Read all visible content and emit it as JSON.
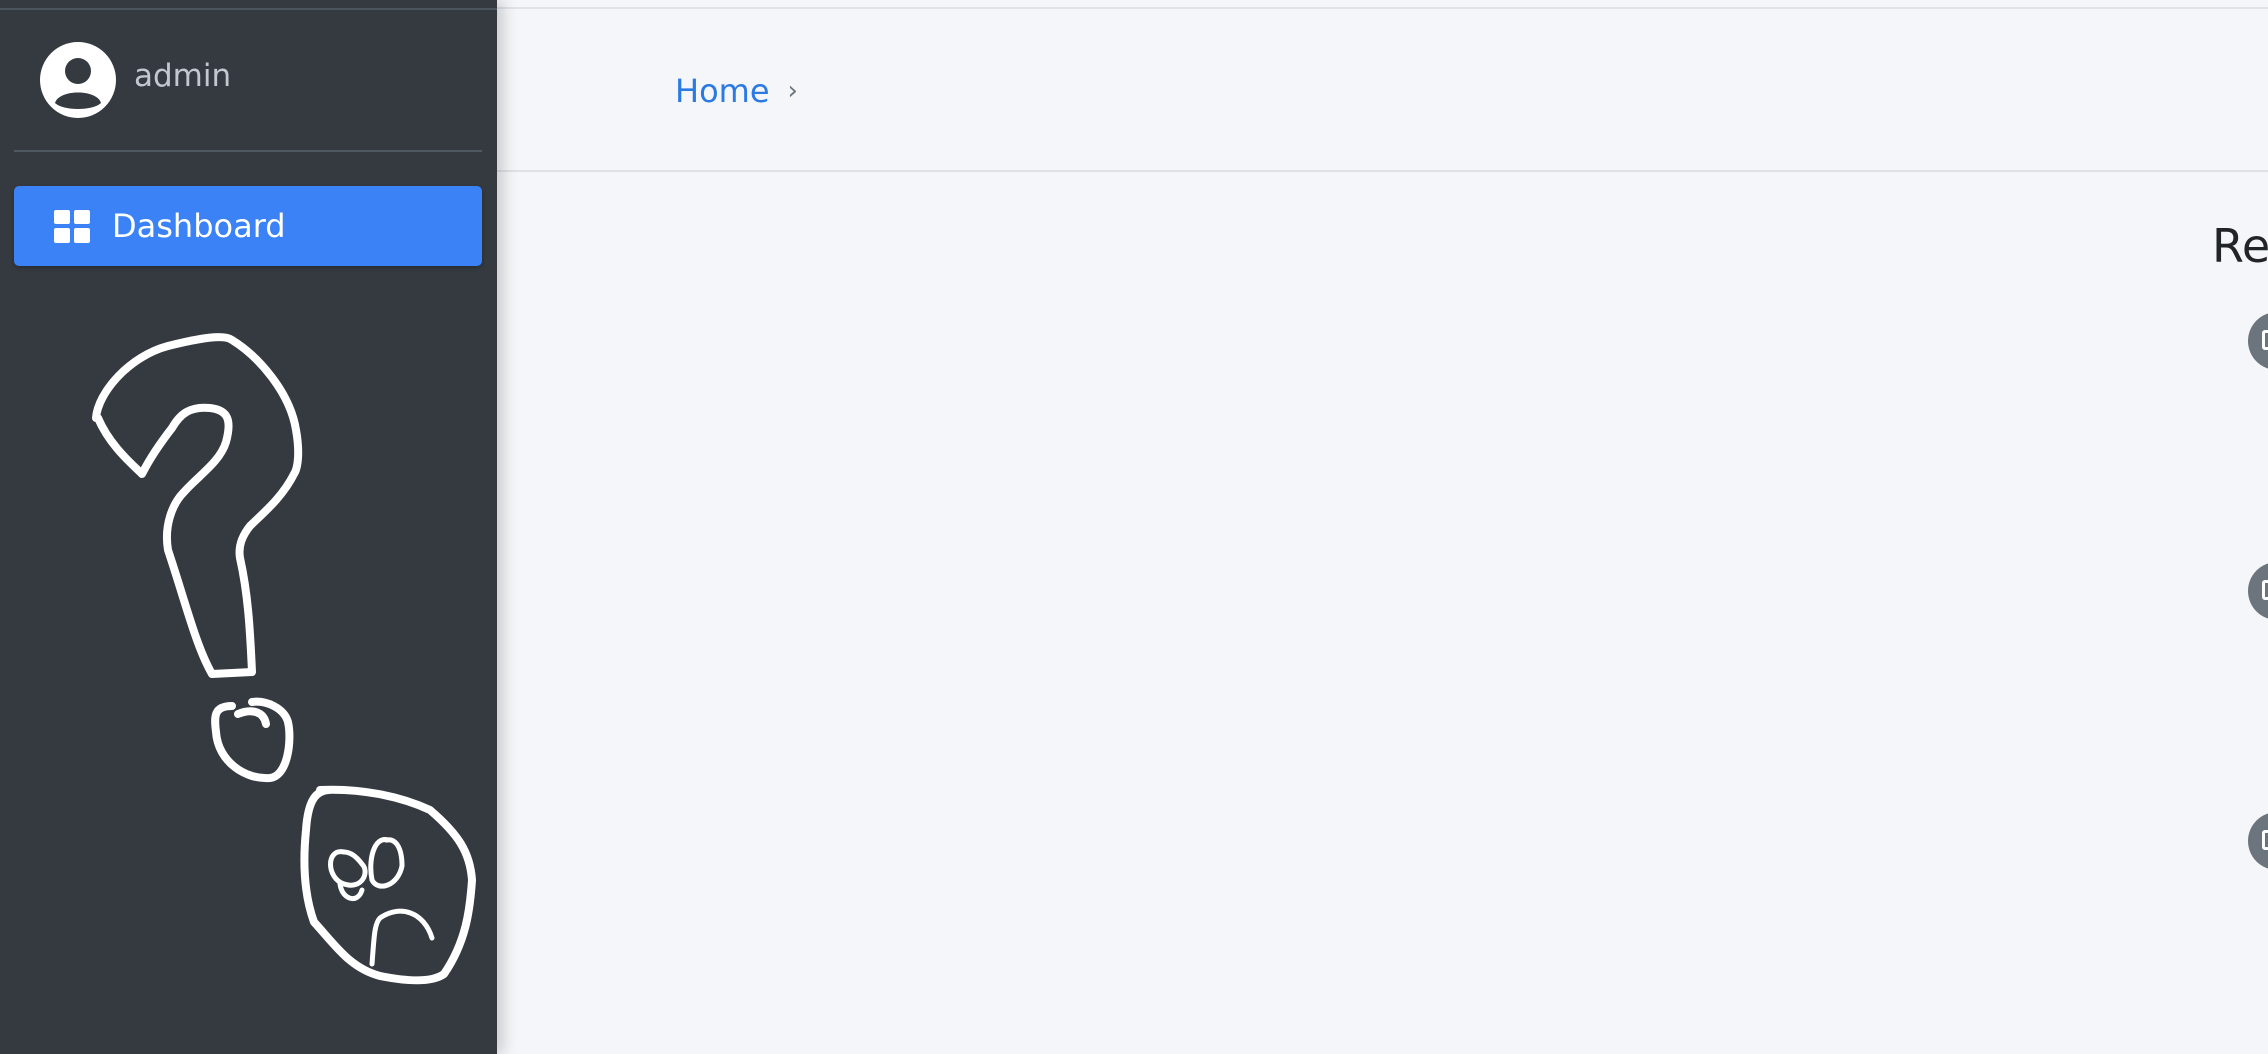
{
  "sidebar": {
    "user": {
      "name": "admin",
      "avatar_icon": "user-circle-icon"
    },
    "nav": [
      {
        "label": "Dashboard",
        "icon": "dashboard-grid-icon",
        "active": true,
        "accent": "#3b82f6"
      }
    ],
    "background": "#343a40"
  },
  "header": {
    "breadcrumb": {
      "home_label": "Home",
      "separator": "›"
    }
  },
  "main": {
    "section_title": "Re",
    "timeline_icons": [
      "calendar-icon",
      "calendar-icon",
      "calendar-icon"
    ]
  }
}
